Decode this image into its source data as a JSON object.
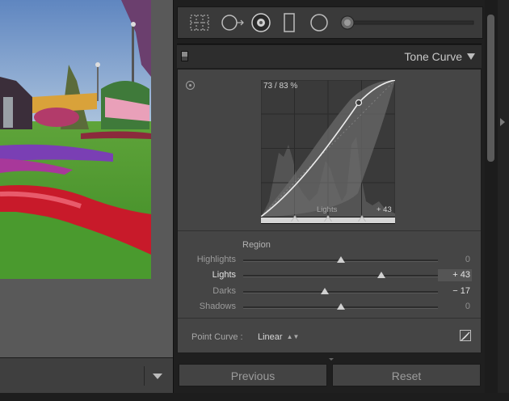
{
  "panel": {
    "title": "Tone Curve",
    "curve": {
      "readout": "73 / 83 %",
      "region_label": "Lights",
      "region_value": "+ 43",
      "split_handles": [
        0.25,
        0.5,
        0.75
      ]
    },
    "region_title": "Region",
    "sliders": [
      {
        "label": "Highlights",
        "value": "0",
        "level": 0.5,
        "active": false
      },
      {
        "label": "Lights",
        "value": "+ 43",
        "level": 0.71,
        "active": true
      },
      {
        "label": "Darks",
        "value": "− 17",
        "level": 0.42,
        "active": false
      },
      {
        "label": "Shadows",
        "value": "0",
        "level": 0.5,
        "active": false
      }
    ],
    "point_curve": {
      "label": "Point Curve :",
      "value": "Linear"
    },
    "buttons": {
      "previous": "Previous",
      "reset": "Reset"
    }
  },
  "icons": {
    "tools": [
      "crop-overlay-icon",
      "spot-removal-icon",
      "red-eye-icon",
      "graduated-filter-icon",
      "radial-filter-icon",
      "adjustment-brush-icon"
    ],
    "others": [
      "target-adjust-icon",
      "edit-point-curve-icon",
      "filmstrip-toggle-icon",
      "panel-collapse-icon"
    ]
  },
  "colors": {
    "panel_bg": "#454545",
    "active_value_bg": "#555555",
    "button_bg": "#434343"
  }
}
